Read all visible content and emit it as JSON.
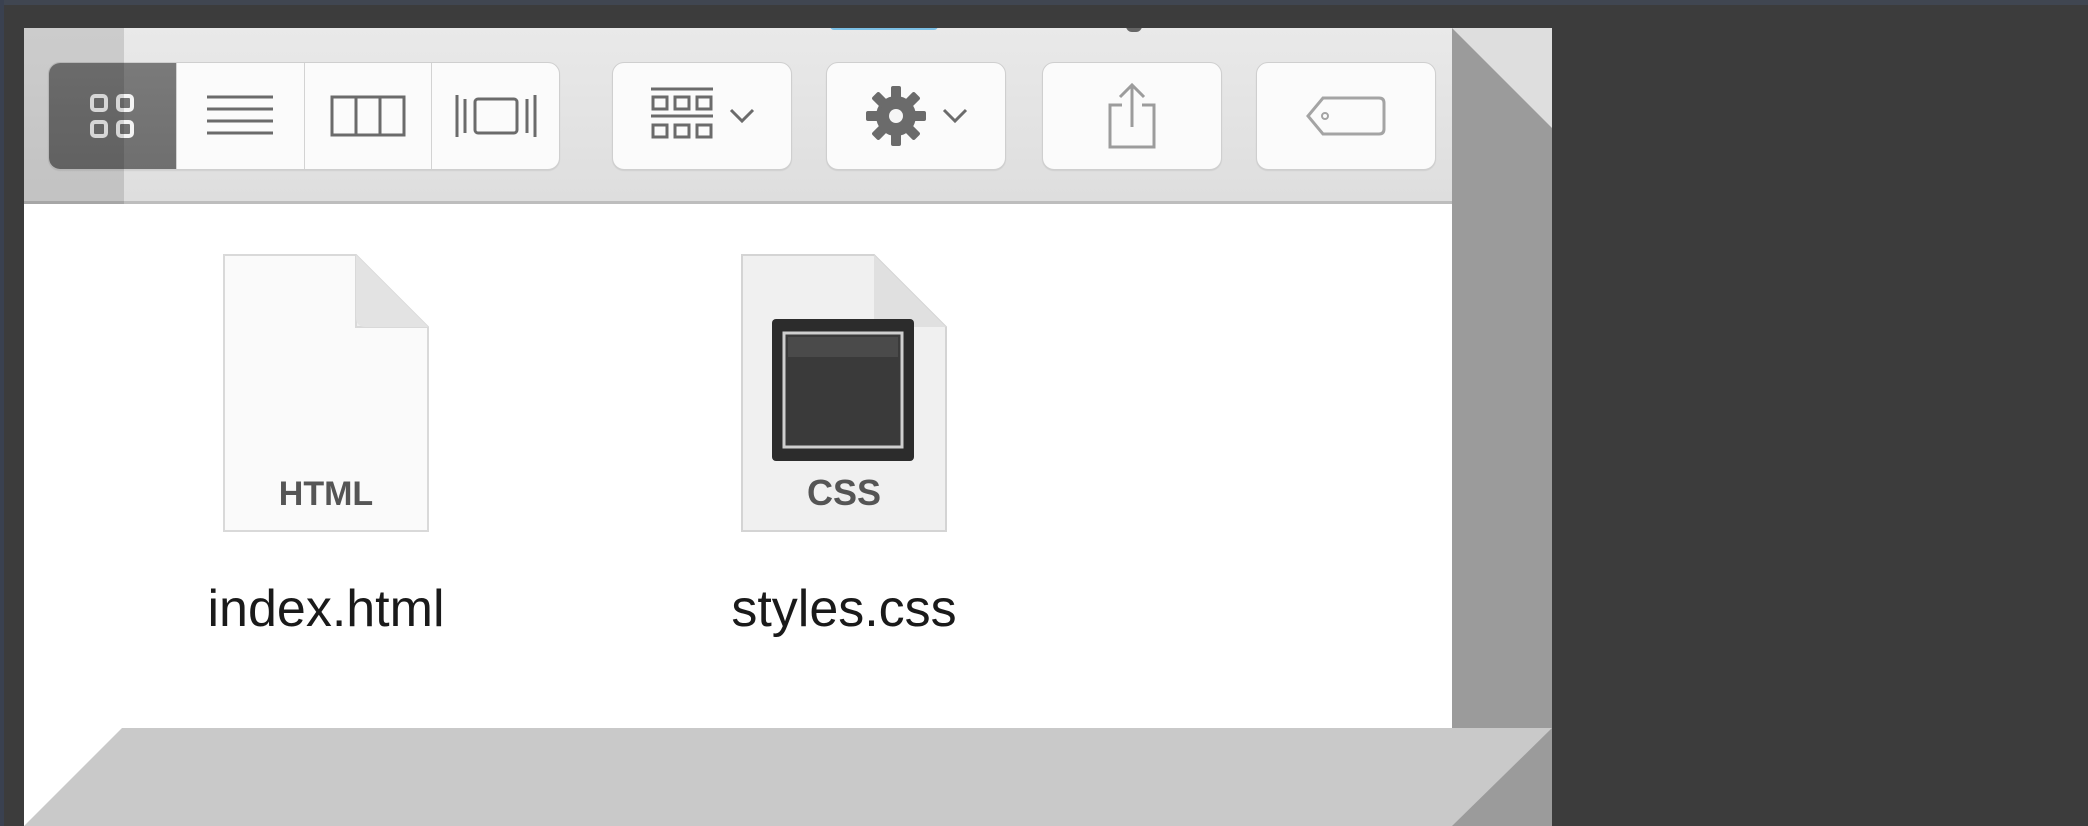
{
  "toolbar": {
    "view_modes": [
      {
        "name": "icon-view",
        "icon": "grid-icon",
        "active": true
      },
      {
        "name": "list-view",
        "icon": "list-icon",
        "active": false
      },
      {
        "name": "column-view",
        "icon": "columns-icon",
        "active": false
      },
      {
        "name": "cover-flow-view",
        "icon": "coverflow-icon",
        "active": false
      }
    ],
    "arrange_icon": "arrange-grid-icon",
    "action_icon": "gear-icon",
    "share_icon": "share-icon",
    "tags_icon": "tag-icon"
  },
  "files": [
    {
      "name": "index.html",
      "badge": "HTML",
      "icon": "html-file-icon"
    },
    {
      "name": "styles.css",
      "badge": "CSS",
      "icon": "css-file-icon"
    }
  ],
  "colors": {
    "desktop": "#3c3c3c",
    "toolbar": "#e4e4e4",
    "active_segment": "#737373",
    "content_bg": "#ffffff"
  }
}
